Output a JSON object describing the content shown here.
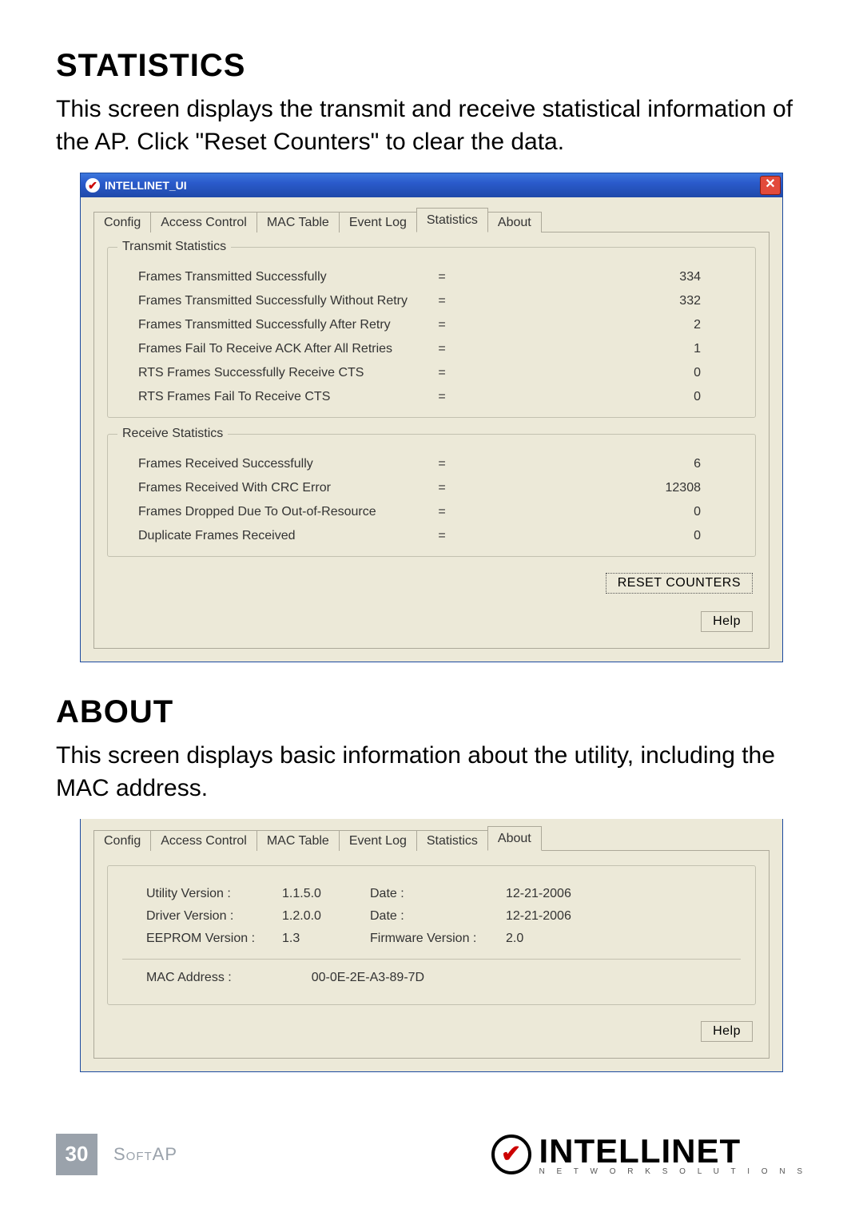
{
  "sections": {
    "statistics": {
      "heading": "STATISTICS",
      "para": "This screen displays the transmit and receive statistical information of the AP. Click \"Reset Counters\" to clear the data."
    },
    "about": {
      "heading": "ABOUT",
      "para": "This screen displays basic information about the utility, including the MAC address."
    }
  },
  "window1": {
    "title": "INTELLINET_UI",
    "tabs": [
      "Config",
      "Access Control",
      "MAC Table",
      "Event Log",
      "Statistics",
      "About"
    ],
    "active_tab_index": 4,
    "transmit_legend": "Transmit Statistics",
    "receive_legend": "Receive Statistics",
    "transmit": [
      {
        "label": "Frames Transmitted Successfully",
        "value": "334"
      },
      {
        "label": "Frames Transmitted Successfully  Without Retry",
        "value": "332"
      },
      {
        "label": "Frames Transmitted Successfully After Retry",
        "value": "2"
      },
      {
        "label": "Frames Fail To Receive ACK After All Retries",
        "value": "1"
      },
      {
        "label": "RTS Frames Successfully Receive CTS",
        "value": "0"
      },
      {
        "label": "RTS Frames Fail To Receive CTS",
        "value": "0"
      }
    ],
    "receive": [
      {
        "label": "Frames Received Successfully",
        "value": "6"
      },
      {
        "label": "Frames Received With CRC Error",
        "value": "12308"
      },
      {
        "label": "Frames Dropped Due To Out-of-Resource",
        "value": "0"
      },
      {
        "label": "Duplicate Frames Received",
        "value": "0"
      }
    ],
    "reset_button": "RESET COUNTERS",
    "help_button": "Help"
  },
  "window2": {
    "tabs": [
      "Config",
      "Access Control",
      "MAC Table",
      "Event Log",
      "Statistics",
      "About"
    ],
    "active_tab_index": 5,
    "rows": [
      {
        "k": "Utility Version :",
        "v": "1.1.5.0",
        "k2": "Date :",
        "v2": "12-21-2006"
      },
      {
        "k": "Driver Version :",
        "v": "1.2.0.0",
        "k2": "Date :",
        "v2": "12-21-2006"
      },
      {
        "k": "EEPROM Version :",
        "v": "1.3",
        "k2": "Firmware Version :",
        "v2": "2.0"
      }
    ],
    "mac_label": "MAC Address :",
    "mac_value": "00-0E-2E-A3-89-7D",
    "help_button": "Help"
  },
  "footer": {
    "page_number": "30",
    "section": "SoftAP",
    "brand_name": "INTELLINET",
    "brand_sub": "N E T W O R K   S O L U T I O N S"
  }
}
